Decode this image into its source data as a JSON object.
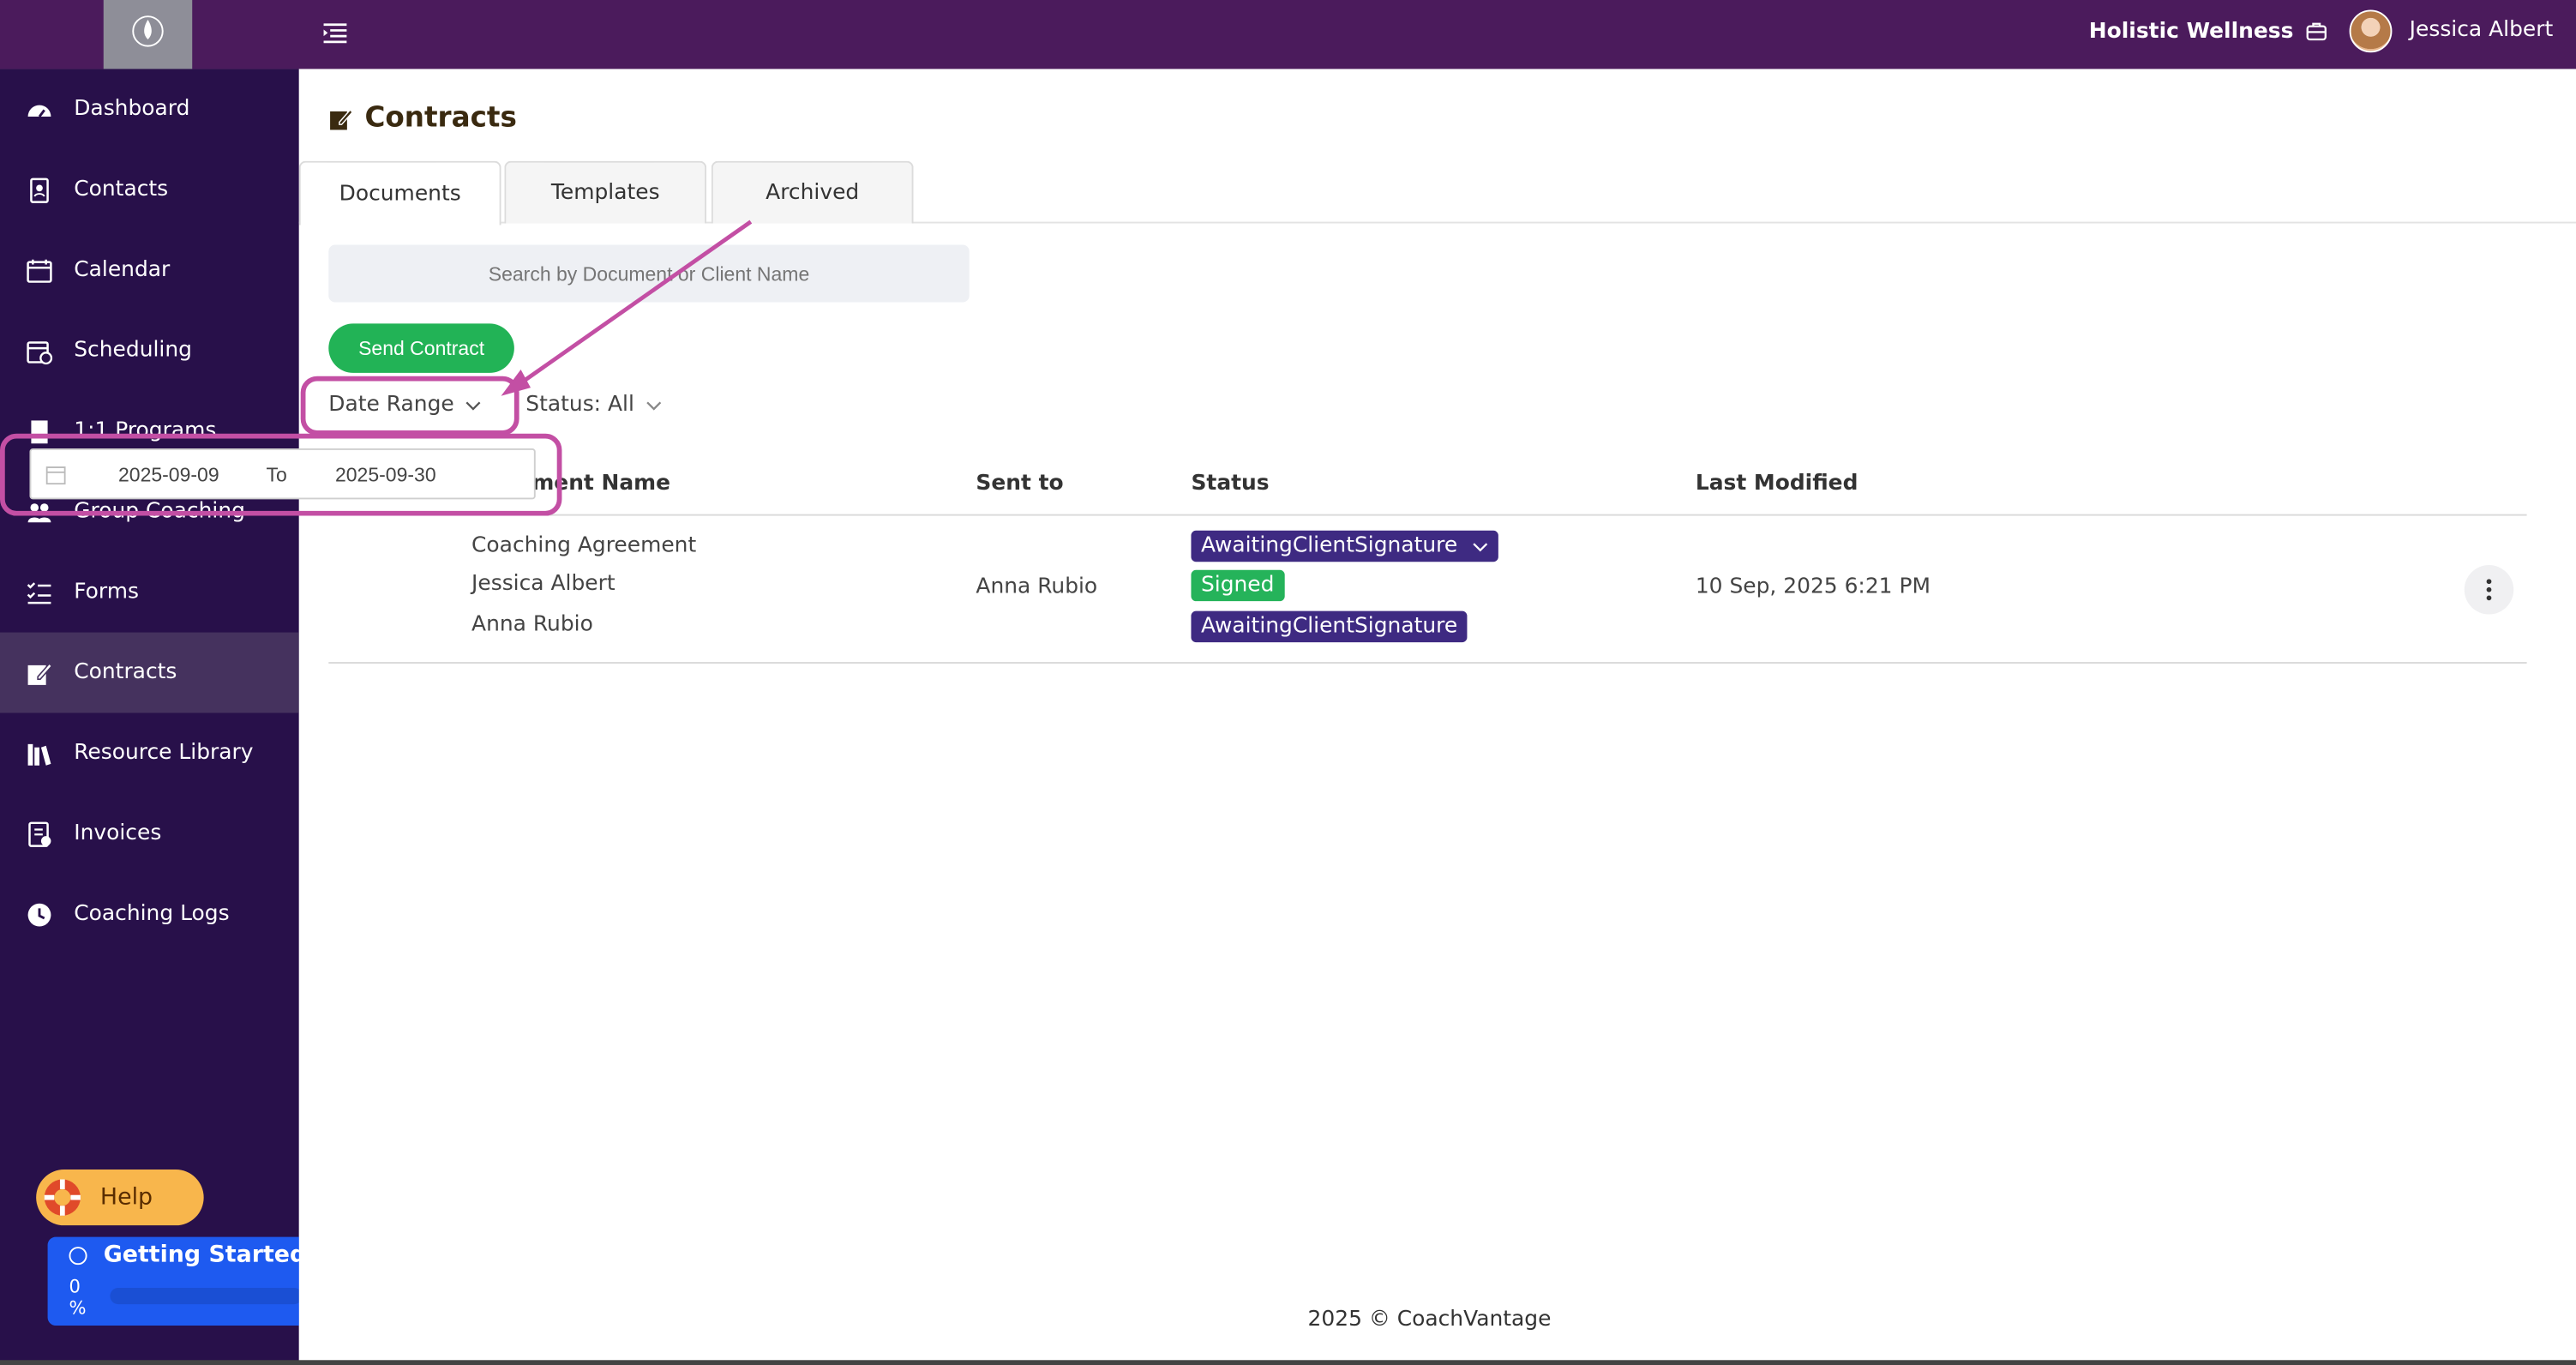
{
  "header": {
    "org_name": "Holistic Wellness",
    "user_name": "Jessica Albert"
  },
  "sidebar": {
    "items": [
      {
        "label": "Dashboard",
        "icon": "dashboard-icon"
      },
      {
        "label": "Contacts",
        "icon": "contacts-icon"
      },
      {
        "label": "Calendar",
        "icon": "calendar-icon"
      },
      {
        "label": "Scheduling",
        "icon": "scheduling-icon"
      },
      {
        "label": "1:1 Programs",
        "icon": "programs-icon"
      },
      {
        "label": "Group Coaching",
        "icon": "group-icon"
      },
      {
        "label": "Forms",
        "icon": "forms-icon"
      },
      {
        "label": "Contracts",
        "icon": "contracts-icon",
        "active": true
      },
      {
        "label": "Resource Library",
        "icon": "library-icon"
      },
      {
        "label": "Invoices",
        "icon": "invoice-icon"
      },
      {
        "label": "Coaching Logs",
        "icon": "clock-icon"
      }
    ],
    "help_label": "Help",
    "getting_started": {
      "title": "Getting Started",
      "progress_label": "0 %",
      "progress": 0
    }
  },
  "page": {
    "title": "Contracts",
    "tabs": [
      "Documents",
      "Templates",
      "Archived"
    ],
    "active_tab": "Documents",
    "search_placeholder": "Search by Document or Client Name",
    "send_button": "Send Contract",
    "filters": {
      "date_range": "Date Range",
      "status": "Status: All"
    },
    "date_range_popup": {
      "from": "2025-09-09",
      "to_label": "To",
      "to": "2025-09-30"
    },
    "table": {
      "headers": [
        "Document Name",
        "Sent to",
        "Status",
        "Last Modified"
      ],
      "rows": [
        {
          "document": "Coaching Agreement",
          "signer_1": "Jessica Albert",
          "signer_2": "Anna Rubio",
          "sent_to": "Anna Rubio",
          "status_main": "AwaitingClientSignature",
          "status_1": "Signed",
          "status_2": "AwaitingClientSignature",
          "last_modified": "10 Sep, 2025 6:21 PM"
        }
      ]
    },
    "footer": "2025 © CoachVantage"
  },
  "colors": {
    "topbar": "#4b1b5c",
    "sidebar": "#28104a",
    "accent_green": "#22b356",
    "badge_purple": "#3e2a82",
    "annotation": "#c34fa4"
  }
}
